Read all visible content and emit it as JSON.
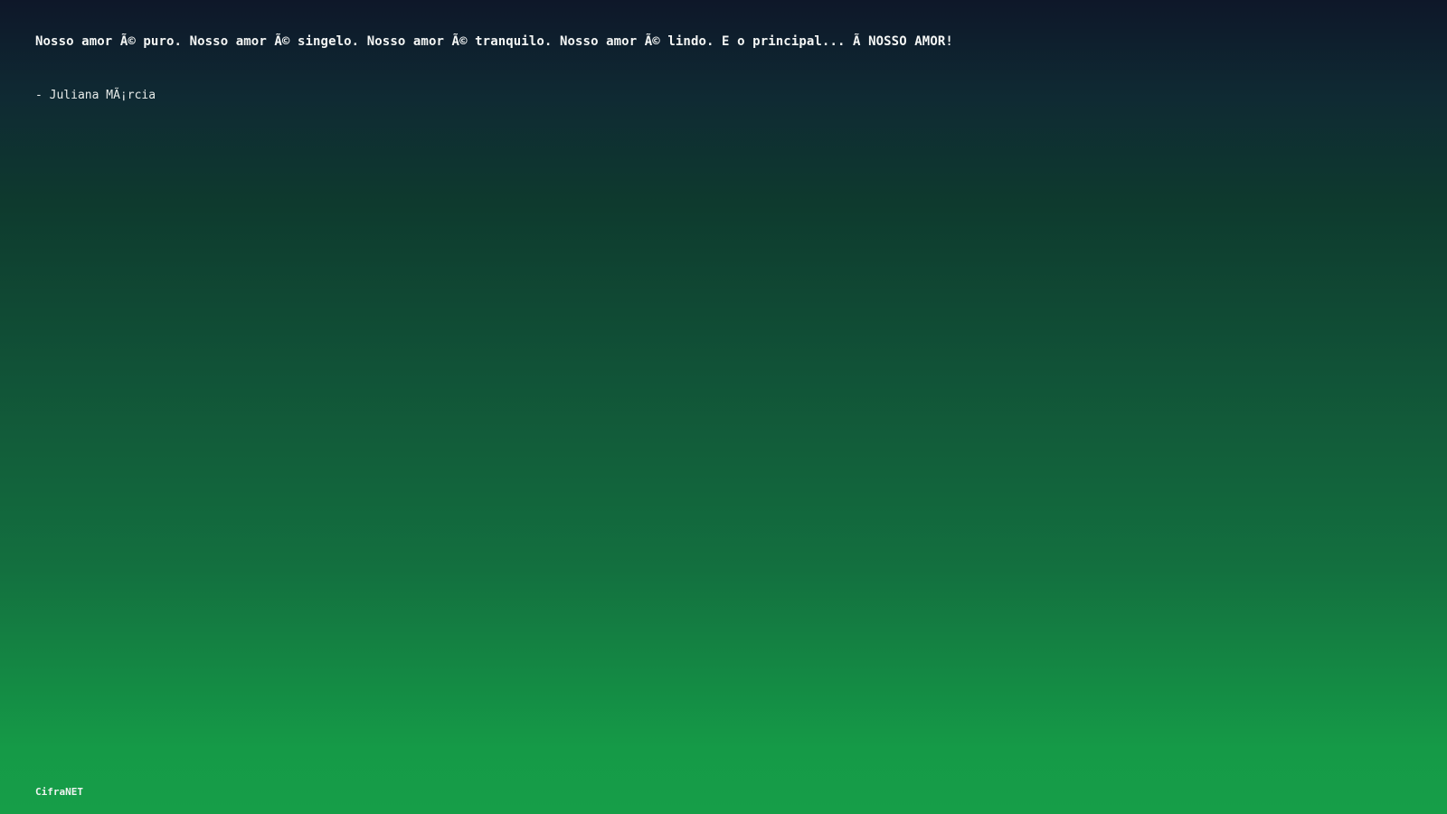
{
  "quote": {
    "text": "Nosso amor Ã© puro. Nosso amor Ã© singelo. Nosso amor Ã© tranquilo. Nosso amor Ã© lindo. E o principal... Ã  NOSSO AMOR!",
    "author": "- Juliana MÃ¡rcia"
  },
  "footer": {
    "brand": "CifraNET"
  },
  "colors": {
    "background_top": "#0e1729",
    "background_bottom": "#169e48",
    "text": "#f4f6f5"
  }
}
